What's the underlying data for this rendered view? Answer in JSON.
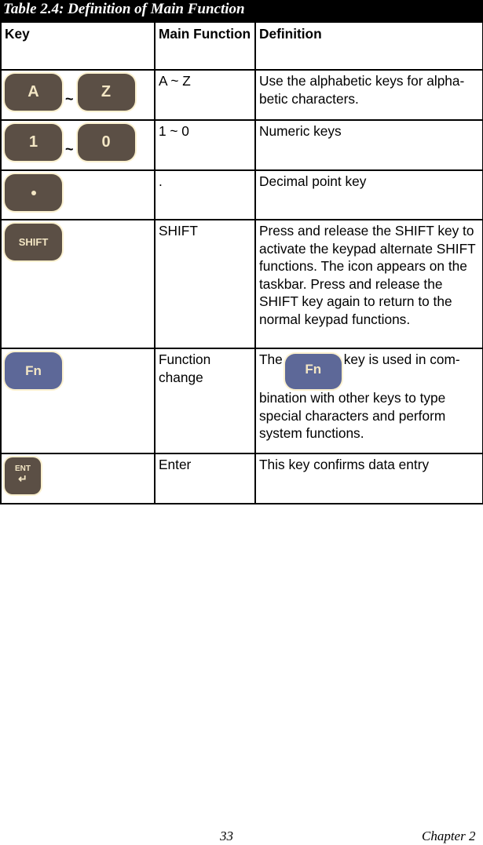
{
  "caption": "Table 2.4: Definition of Main Function",
  "headers": {
    "key": "Key",
    "main_function": "Main Function",
    "definition": "Definition"
  },
  "rows": [
    {
      "keys": [
        "A",
        "Z"
      ],
      "separator": "~",
      "main_function": "A ~ Z",
      "definition": "Use the alphabetic keys for alpha-betic characters."
    },
    {
      "keys": [
        "1",
        "0"
      ],
      "separator": "~",
      "main_function": "1 ~ 0",
      "definition": "Numeric keys"
    },
    {
      "keys": [
        "•"
      ],
      "main_function": ".",
      "definition": "Decimal point key"
    },
    {
      "keys": [
        "SHIFT"
      ],
      "main_function": "SHIFT",
      "definition": "Press and release the SHIFT key to activate the keypad alternate SHIFT functions. The icon appears on the taskbar. Press and release the SHIFT key again to return to the normal keypad functions."
    },
    {
      "keys": [
        "Fn"
      ],
      "main_function": "Function change",
      "definition_pre": "The",
      "definition_key": "Fn",
      "definition_post": "key is used in com-bination with other keys to type special characters and perform system functions."
    },
    {
      "keys": [
        "ENT"
      ],
      "key_sub_icon": "↵",
      "main_function": "Enter",
      "definition": "This key confirms data entry"
    }
  ],
  "footer": {
    "page_number": "33",
    "chapter": "Chapter 2"
  },
  "colors": {
    "key_brown": "#5b4f45",
    "key_blue": "#5d6898",
    "key_text": "#f3e6c4"
  }
}
